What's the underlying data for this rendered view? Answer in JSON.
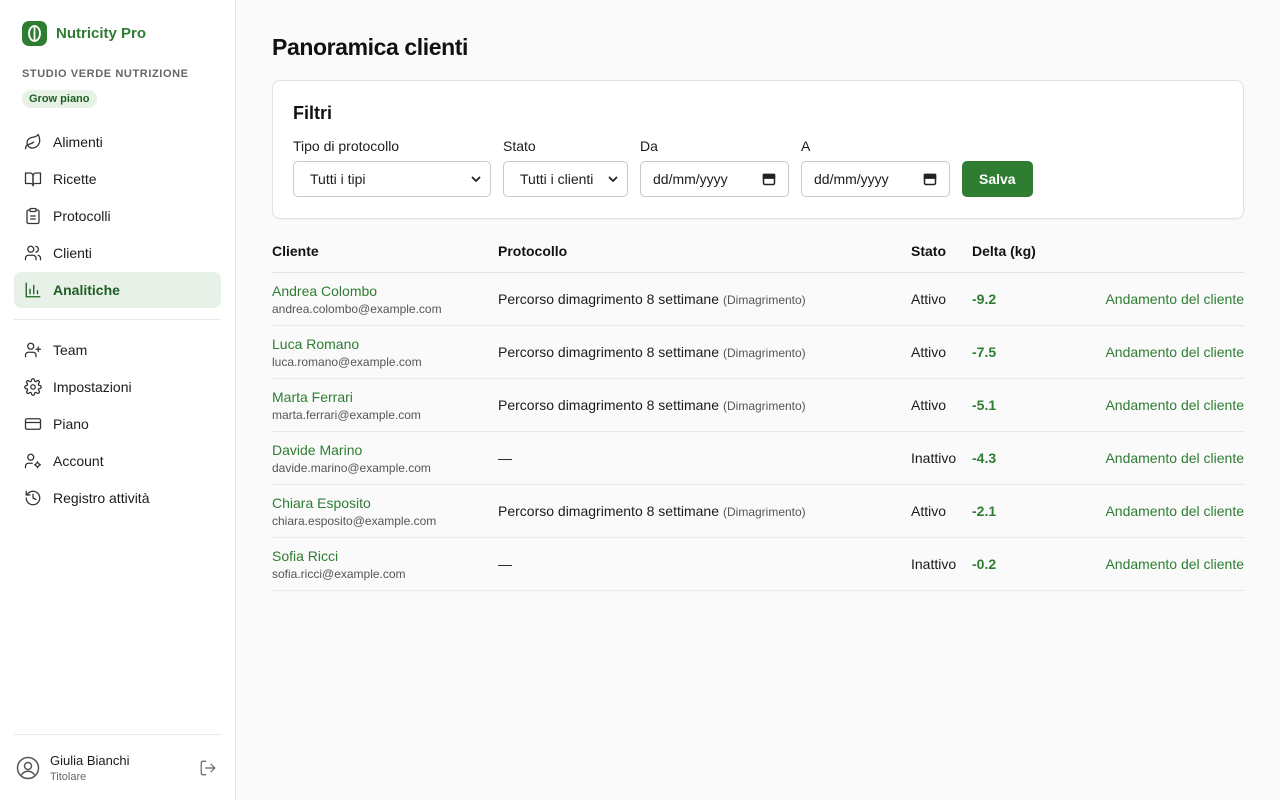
{
  "brand": {
    "name": "Nutricity Pro",
    "color": "#2e7d32"
  },
  "org": {
    "name": "STUDIO VERDE NUTRIZIONE",
    "plan_badge": "Grow piano"
  },
  "nav": {
    "primary": [
      {
        "label": "Alimenti",
        "icon": "leaf-icon"
      },
      {
        "label": "Ricette",
        "icon": "book-icon"
      },
      {
        "label": "Protocolli",
        "icon": "clipboard-icon"
      },
      {
        "label": "Clienti",
        "icon": "users-icon"
      },
      {
        "label": "Analitiche",
        "icon": "bar-chart-icon",
        "active": true
      }
    ],
    "secondary": [
      {
        "label": "Team",
        "icon": "user-plus-icon"
      },
      {
        "label": "Impostazioni",
        "icon": "gear-icon"
      },
      {
        "label": "Piano",
        "icon": "credit-card-icon"
      },
      {
        "label": "Account",
        "icon": "user-cog-icon"
      },
      {
        "label": "Registro attività",
        "icon": "history-icon"
      }
    ]
  },
  "user": {
    "name": "Giulia Bianchi",
    "role": "Titolare"
  },
  "page": {
    "title": "Panoramica clienti"
  },
  "filters": {
    "title": "Filtri",
    "protocol_label": "Tipo di protocollo",
    "protocol_value": "Tutti i tipi",
    "state_label": "Stato",
    "state_value": "Tutti i clienti",
    "from_label": "Da",
    "from_placeholder": "dd/mm/yyyy",
    "to_label": "A",
    "to_placeholder": "dd/mm/yyyy",
    "save_label": "Salva"
  },
  "table": {
    "headers": {
      "client": "Cliente",
      "protocol": "Protocollo",
      "state": "Stato",
      "delta": "Delta (kg)"
    },
    "link_label": "Andamento del cliente",
    "rows": [
      {
        "name": "Andrea Colombo",
        "email": "andrea.colombo@example.com",
        "protocol": "Percorso dimagrimento 8 settimane",
        "protocol_type": "(Dimagrimento)",
        "state": "Attivo",
        "delta": "-9.2"
      },
      {
        "name": "Luca Romano",
        "email": "luca.romano@example.com",
        "protocol": "Percorso dimagrimento 8 settimane",
        "protocol_type": "(Dimagrimento)",
        "state": "Attivo",
        "delta": "-7.5"
      },
      {
        "name": "Marta Ferrari",
        "email": "marta.ferrari@example.com",
        "protocol": "Percorso dimagrimento 8 settimane",
        "protocol_type": "(Dimagrimento)",
        "state": "Attivo",
        "delta": "-5.1"
      },
      {
        "name": "Davide Marino",
        "email": "davide.marino@example.com",
        "protocol": "—",
        "protocol_type": "",
        "state": "Inattivo",
        "delta": "-4.3"
      },
      {
        "name": "Chiara Esposito",
        "email": "chiara.esposito@example.com",
        "protocol": "Percorso dimagrimento 8 settimane",
        "protocol_type": "(Dimagrimento)",
        "state": "Attivo",
        "delta": "-2.1"
      },
      {
        "name": "Sofia Ricci",
        "email": "sofia.ricci@example.com",
        "protocol": "—",
        "protocol_type": "",
        "state": "Inattivo",
        "delta": "-0.2"
      }
    ]
  }
}
